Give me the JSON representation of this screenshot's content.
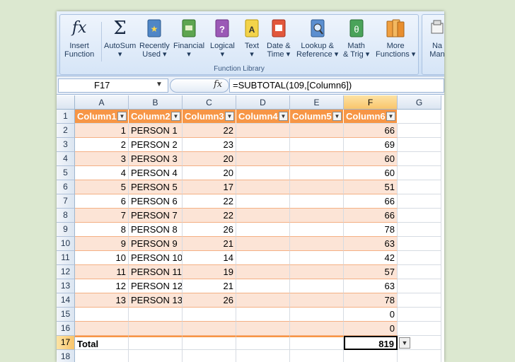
{
  "ribbon": {
    "group_label": "Function Library",
    "buttons": [
      {
        "line1": "Insert",
        "line2": "Function",
        "icon": "fx-icon"
      },
      {
        "line1": "AutoSum",
        "line2": "▾",
        "icon": "sigma-icon"
      },
      {
        "line1": "Recently",
        "line2": "Used ▾",
        "icon": "book-star-icon"
      },
      {
        "line1": "Financial",
        "line2": "▾",
        "icon": "book-money-icon"
      },
      {
        "line1": "Logical",
        "line2": "▾",
        "icon": "book-question-icon"
      },
      {
        "line1": "Text",
        "line2": "▾",
        "icon": "book-a-icon"
      },
      {
        "line1": "Date &",
        "line2": "Time ▾",
        "icon": "book-calendar-icon"
      },
      {
        "line1": "Lookup &",
        "line2": "Reference ▾",
        "icon": "book-magnifier-icon"
      },
      {
        "line1": "Math",
        "line2": "& Trig ▾",
        "icon": "book-theta-icon"
      },
      {
        "line1": "More",
        "line2": "Functions ▾",
        "icon": "books-icon"
      }
    ],
    "next_group": {
      "line1": "Na",
      "line2": "Man"
    }
  },
  "formula_bar": {
    "name_box": "F17",
    "fx": "fx",
    "formula": "=SUBTOTAL(109,[Column6])"
  },
  "columns": [
    "A",
    "B",
    "C",
    "D",
    "E",
    "F",
    "G"
  ],
  "selected_column": "F",
  "table": {
    "headers": [
      "Column1",
      "Column2",
      "Column3",
      "Column4",
      "Column5",
      "Column6"
    ],
    "rows": [
      [
        "1",
        "PERSON 1",
        "22",
        "",
        "",
        "66"
      ],
      [
        "2",
        "PERSON 2",
        "23",
        "",
        "",
        "69"
      ],
      [
        "3",
        "PERSON 3",
        "20",
        "",
        "",
        "60"
      ],
      [
        "4",
        "PERSON 4",
        "20",
        "",
        "",
        "60"
      ],
      [
        "5",
        "PERSON 5",
        "17",
        "",
        "",
        "51"
      ],
      [
        "6",
        "PERSON 6",
        "22",
        "",
        "",
        "66"
      ],
      [
        "7",
        "PERSON 7",
        "22",
        "",
        "",
        "66"
      ],
      [
        "8",
        "PERSON 8",
        "26",
        "",
        "",
        "78"
      ],
      [
        "9",
        "PERSON 9",
        "21",
        "",
        "",
        "63"
      ],
      [
        "10",
        "PERSON 10",
        "14",
        "",
        "",
        "42"
      ],
      [
        "11",
        "PERSON 11",
        "19",
        "",
        "",
        "57"
      ],
      [
        "12",
        "PERSON 12",
        "21",
        "",
        "",
        "63"
      ],
      [
        "13",
        "PERSON 13",
        "26",
        "",
        "",
        "78"
      ],
      [
        "",
        "",
        "",
        "",
        "",
        "0"
      ],
      [
        "",
        "",
        "",
        "",
        "",
        "0"
      ]
    ],
    "total_label": "Total",
    "total_value": "819"
  },
  "row_numbers": [
    "1",
    "2",
    "3",
    "4",
    "5",
    "6",
    "7",
    "8",
    "9",
    "10",
    "11",
    "12",
    "13",
    "14",
    "15",
    "16",
    "17",
    "18"
  ],
  "selected_row": "17",
  "colors": {
    "header_orange": "#f79646",
    "band": "#fce4d6",
    "selection": "#f9c56b"
  }
}
